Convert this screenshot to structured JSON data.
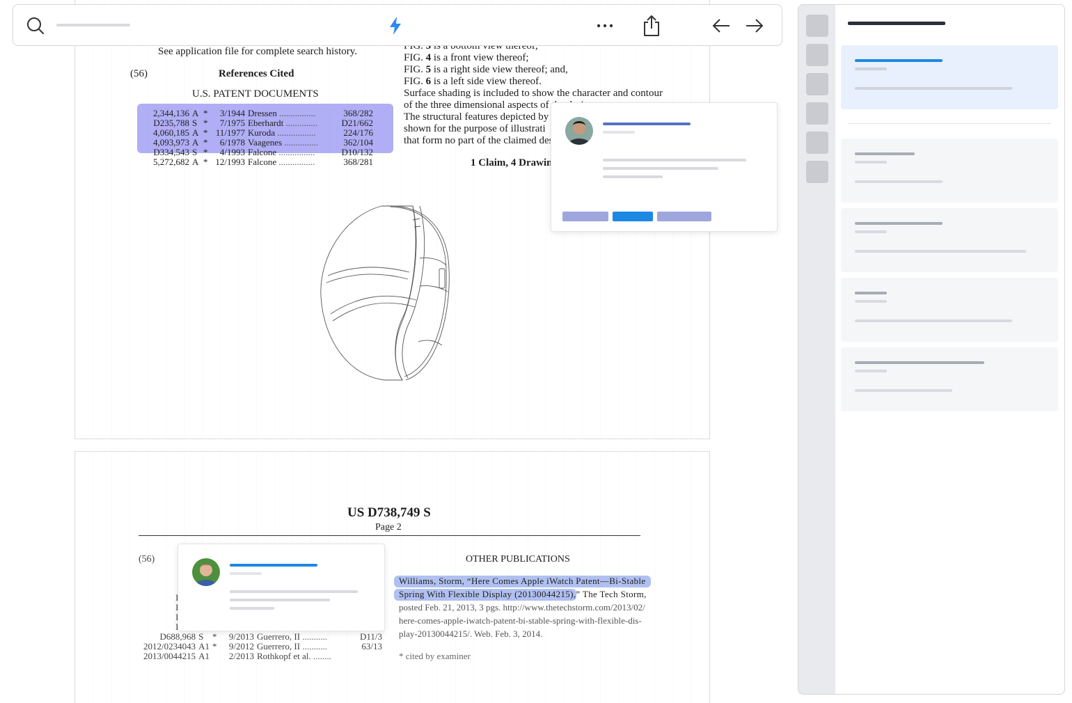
{
  "page1": {
    "search_history_note": "See application file for complete search history.",
    "references_code": "(56)",
    "references_heading": "References Cited",
    "us_docs_heading": "U.S. PATENT DOCUMENTS",
    "references": [
      {
        "num": "2,344,136",
        "kind": "A",
        "star": "*",
        "date": "3/1944",
        "name": "Dressen",
        "cls": "368/282"
      },
      {
        "num": "D235,788",
        "kind": "S",
        "star": "*",
        "date": "7/1975",
        "name": "Eberhardt",
        "cls": "D21/662"
      },
      {
        "num": "4,060,185",
        "kind": "A",
        "star": "*",
        "date": "11/1977",
        "name": "Kuroda",
        "cls": "224/176"
      },
      {
        "num": "4,093,973",
        "kind": "A",
        "star": "*",
        "date": "6/1978",
        "name": "Vaagenes",
        "cls": "362/104"
      },
      {
        "num": "D334,543",
        "kind": "S",
        "star": "*",
        "date": "4/1993",
        "name": "Falcone",
        "cls": "D10/132"
      },
      {
        "num": "5,272,682",
        "kind": "A",
        "star": "*",
        "date": "12/1993",
        "name": "Falcone",
        "cls": "368/281"
      }
    ],
    "fig_lines": [
      {
        "pre": "FIG. ",
        "num": "3",
        "post": " is a bottom view thereof;"
      },
      {
        "pre": "FIG. ",
        "num": "4",
        "post": " is a front view thereof;"
      },
      {
        "pre": "FIG. ",
        "num": "5",
        "post": " is a right side view thereof; and,"
      },
      {
        "pre": "FIG. ",
        "num": "6",
        "post": " is a left side view thereof."
      }
    ],
    "desc_lines": [
      "Surface shading is included to show the character and contour",
      "of the three dimensional aspects of the design.",
      "The structural features depicted by",
      "shown for the purpose of illustrati",
      "that form no part of the claimed des"
    ],
    "claims": "1 Claim, 4 Drawin"
  },
  "page2": {
    "patent_number": "US D738,749 S",
    "page_label": "Page 2",
    "references_code": "(56)",
    "other_pub_heading": "OTHER PUBLICATIONS",
    "pub_lines": [
      "Williams, Storm, “Here Comes Apple iWatch Patent—Bi-Stable",
      "Spring With Flexible Display (20130044215),”",
      "posted Feb. 21, 2013, 3 pgs. http://www.thetechstorm.com/2013/02/",
      "here-comes-apple-iwatch-patent-bi-stable-spring-with-flexible-dis-",
      "play-20130044215/. Web. Feb. 3, 2014."
    ],
    "pub_line2_tail": " The Tech Storm,",
    "cited_note": "* cited by examiner",
    "left_refs_visible": [
      {
        "num": "D637",
        "kind": "",
        "star": "",
        "date": "",
        "name": "",
        "cls": ""
      },
      {
        "num": "D638",
        "kind": "",
        "star": "",
        "date": "",
        "name": "",
        "cls": ""
      },
      {
        "num": "D638",
        "kind": "",
        "star": "",
        "date": "",
        "name": "",
        "cls": ""
      },
      {
        "num": "D687",
        "kind": "",
        "star": "",
        "date": "",
        "name": "",
        "cls": ""
      },
      {
        "num": "D688,968",
        "kind": "S",
        "star": "*",
        "date": "9/2013",
        "name": "Guerrero, II",
        "cls": "D11/3"
      },
      {
        "num": "2012/0234043",
        "kind": "A1",
        "star": "*",
        "date": "9/2012",
        "name": "Guerrero, II",
        "cls": "63/13"
      },
      {
        "num": "2013/0044215",
        "kind": "A1",
        "star": "",
        "date": "2/2013",
        "name": "Rothkopf et al.",
        "cls": ""
      }
    ]
  },
  "toolbar": {
    "icons": [
      "search-icon",
      "bolt-icon",
      "more-icon",
      "share-icon",
      "arrow-left-icon",
      "arrow-right-icon"
    ],
    "accent": "#2a8af0"
  },
  "colors": {
    "highlight_reference": "#706ceb",
    "highlight_publication": "#6282e1",
    "placeholder_bar": "#d8dadf",
    "accent_blue": "#1e88e5",
    "panel_bg": "#e9eaed"
  }
}
